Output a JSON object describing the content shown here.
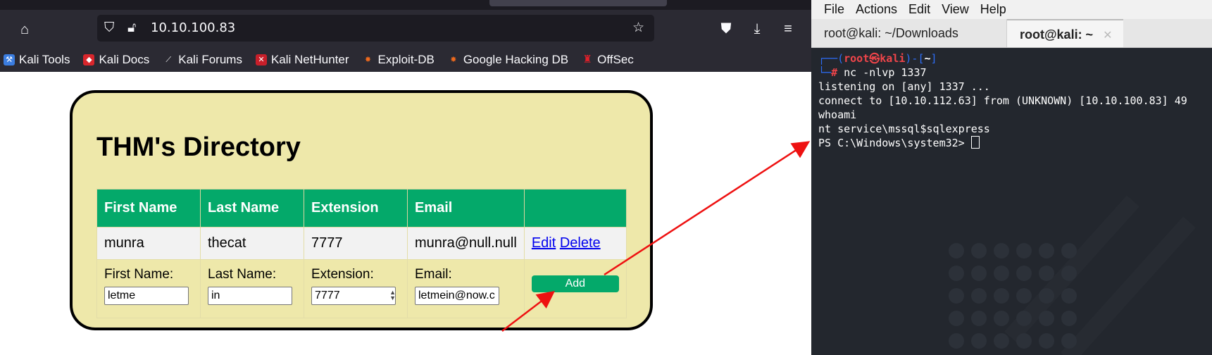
{
  "browser": {
    "url": "10.10.100.83",
    "bookmarks": [
      "Kali Tools",
      "Kali Docs",
      "Kali Forums",
      "Kali NetHunter",
      "Exploit-DB",
      "Google Hacking DB",
      "OffSec"
    ],
    "page": {
      "title": "THM's Directory",
      "headers": [
        "First Name",
        "Last Name",
        "Extension",
        "Email"
      ],
      "rows": [
        {
          "first": "munra",
          "last": "thecat",
          "ext": "7777",
          "email": "munra@null.null",
          "edit": "Edit",
          "delete": "Delete"
        }
      ],
      "form": {
        "first_label": "First Name:",
        "first_value": "letme",
        "last_label": "Last Name:",
        "last_value": "in",
        "ext_label": "Extension:",
        "ext_value": "7777",
        "email_label": "Email:",
        "email_value": "letmein@now.c",
        "add_label": "Add"
      }
    }
  },
  "terminal": {
    "menu": [
      "File",
      "Actions",
      "Edit",
      "View",
      "Help"
    ],
    "tabs": [
      "root@kali: ~/Downloads",
      "root@kali: ~"
    ],
    "prompt_user": "root",
    "prompt_at": "㉿",
    "prompt_host": "kali",
    "prompt_dir": "~",
    "command": "nc -nlvp 1337",
    "output": [
      "listening on [any] 1337 ...",
      "connect to [10.10.112.63] from (UNKNOWN) [10.10.100.83] 49",
      "whoami",
      "nt service\\mssql$sqlexpress",
      "PS C:\\Windows\\system32> "
    ]
  },
  "colors": {
    "accent_green": "#04a96a",
    "card_bg": "#eee8aa",
    "terminal_bg": "#23272e",
    "arrow": "#ee1111"
  }
}
